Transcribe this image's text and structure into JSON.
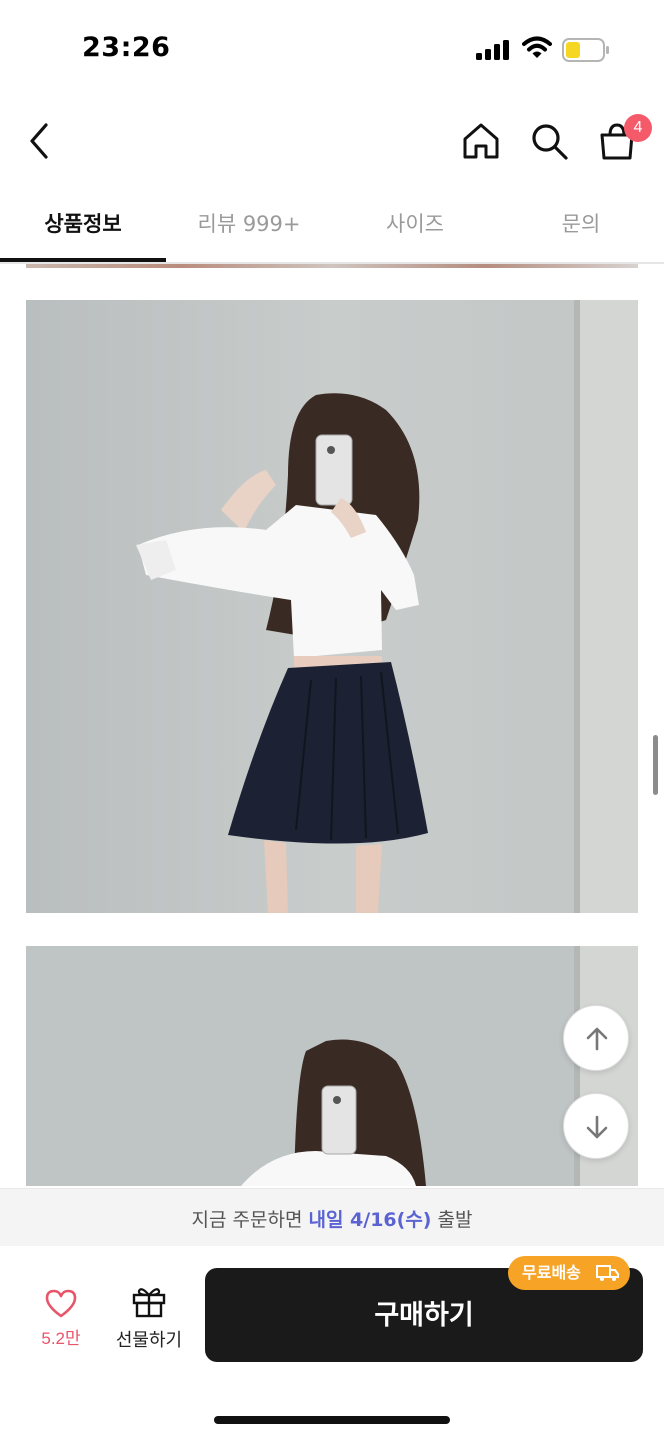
{
  "status_bar": {
    "time": "23:26",
    "icons": [
      "signal-icon",
      "wifi-icon",
      "battery-icon"
    ],
    "battery_color": "#f5d623"
  },
  "nav": {
    "icons": [
      "back-icon",
      "home-icon",
      "search-icon",
      "cart-icon"
    ],
    "cart_count": "4",
    "badge_color": "#f55a6a"
  },
  "tabs": [
    {
      "label": "상품정보",
      "active": true
    },
    {
      "label": "리뷰 999+",
      "active": false
    },
    {
      "label": "사이즈",
      "active": false
    },
    {
      "label": "문의",
      "active": false
    }
  ],
  "scroll_buttons": {
    "icons": [
      "arrow-up-icon",
      "arrow-down-icon"
    ]
  },
  "shipping_notice": {
    "prefix": "지금 주문하면 ",
    "highlight": "내일 4/16(수)",
    "suffix": " 출발",
    "highlight_color": "#5b63d3"
  },
  "action_bar": {
    "like_count": "5.2만",
    "like_icon": "heart-icon",
    "gift_label": "선물하기",
    "gift_icon": "gift-icon",
    "buy_label": "구매하기",
    "free_shipping_label": "무료배송",
    "free_shipping_icon": "truck-icon",
    "badge_color": "#f7a326",
    "like_color": "#e8556a"
  }
}
